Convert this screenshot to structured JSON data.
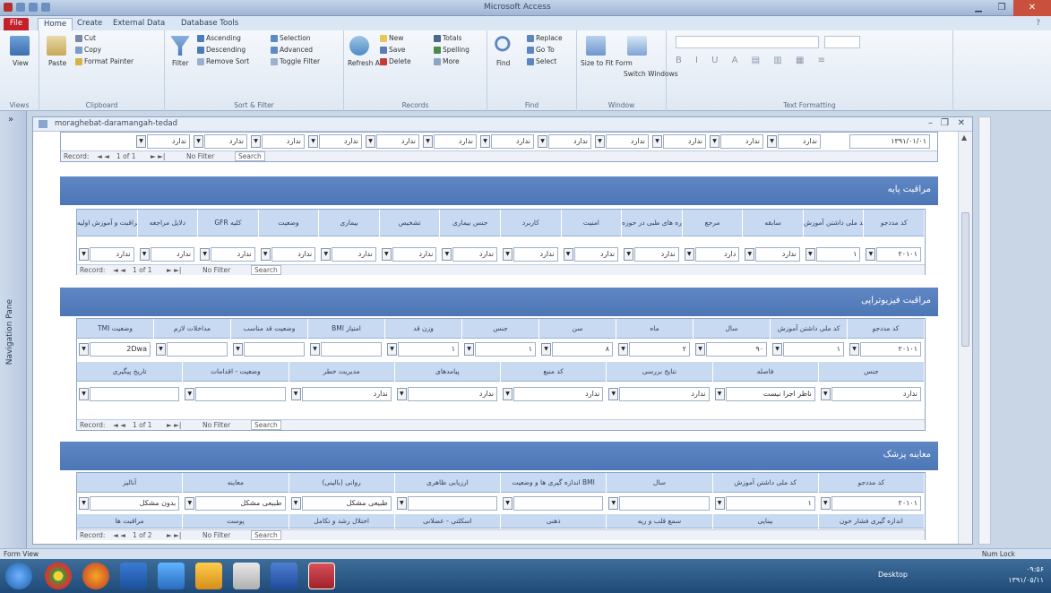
{
  "window": {
    "title": "Microsoft Access"
  },
  "ribbon": {
    "tabs": [
      "File",
      "Home",
      "Create",
      "External Data",
      "Database Tools"
    ],
    "groups": {
      "views": {
        "label": "Views",
        "button": "View"
      },
      "clipboard": {
        "label": "Clipboard",
        "paste": "Paste",
        "cut": "Cut",
        "copy": "Copy",
        "format_painter": "Format Painter"
      },
      "sort_filter": {
        "label": "Sort & Filter",
        "filter": "Filter",
        "ascending": "Ascending",
        "descending": "Descending",
        "remove_sort": "Remove Sort",
        "selection": "Selection",
        "advanced": "Advanced",
        "toggle_filter": "Toggle Filter"
      },
      "records": {
        "label": "Records",
        "refresh": "Refresh All",
        "new": "New",
        "save": "Save",
        "delete": "Delete",
        "totals": "Totals",
        "spelling": "Spelling",
        "more": "More"
      },
      "find": {
        "label": "Find",
        "find": "Find",
        "replace": "Replace",
        "goto": "Go To",
        "select": "Select"
      },
      "window": {
        "label": "Window",
        "size": "Size to Fit Form",
        "switch": "Switch Windows"
      },
      "text_formatting": {
        "label": "Text Formatting"
      }
    }
  },
  "nav_pane": {
    "label": "Navigation Pane"
  },
  "document": {
    "title": "moraghebat-daramangah-tedad",
    "top_strip": {
      "first_value": "۱۳۹۱/۰۱/۰۱",
      "values": [
        "ندارد",
        "ندارد",
        "ندارد",
        "ندارد",
        "ندارد",
        "ندارد",
        "ندارد",
        "ندارد",
        "ندارد",
        "ندارد",
        "ندارد",
        "ندارد"
      ]
    },
    "recnav1": {
      "record": "Record:",
      "pos": "1 of 1",
      "filter": "No Filter",
      "search": "Search"
    },
    "section1": {
      "title": "مراقبت پایه",
      "headers": [
        "کد مددجو",
        "کد ملی داشتن آموزش",
        "سابقه",
        "مرجع",
        "مشاوره های طبی در حوزه",
        "امنیت",
        "کاربرد",
        "جنس بیماری",
        "تشخیص",
        "بیماری",
        "وضعیت",
        "GFR کلیه",
        "دلایل مراجعه",
        "مراقبت و آموزش اولیه"
      ],
      "values": [
        "۲۰۱۰۱",
        "۱",
        "ندارد",
        "دارد",
        "ندارد",
        "ندارد",
        "ندارد",
        "ندارد",
        "ندارد",
        "ندارد",
        "ندارد",
        "ندارد",
        "ندارد",
        "ندارد"
      ]
    },
    "recnav2": {
      "record": "Record:",
      "pos": "1 of 1",
      "filter": "No Filter",
      "search": "Search"
    },
    "section2": {
      "title": "مراقبت فیزیوتراپی",
      "headers_top": [
        "کد مددجو",
        "کد ملی داشتن آموزش",
        "سال",
        "ماه",
        "سن",
        "جنس",
        "وزن قد",
        "BMI امتیاز",
        "وضعیت قد مناسب",
        "مداخلات لازم",
        "TMI وضعیت"
      ],
      "values_top": [
        "۲۰۱۰۱",
        "۱",
        "۹۰",
        "۲",
        "۸",
        "۱",
        "۱",
        "",
        "",
        "",
        "2Dwa"
      ],
      "headers_bottom": [
        "جنس",
        "فاصله",
        "نتایج بررسی",
        "کد منبع",
        "پیامدهای",
        "مدیریت خطر",
        "وضعیت - اقدامات",
        "تاریخ پیگیری"
      ],
      "values_bottom": [
        "ندارد",
        "ناظر اجرا نیست",
        "ندارد",
        "ندارد",
        "ندارد",
        "ندارد",
        "",
        ""
      ]
    },
    "recnav3": {
      "record": "Record:",
      "pos": "1 of 1",
      "filter": "No Filter",
      "search": "Search"
    },
    "section3": {
      "title": "معاینه پزشک",
      "headers": [
        "کد مددجو",
        "کد ملی داشتن آموزش",
        "سال",
        "اندازه گیری ها و وضعیت BMI",
        "ارزیابی ظاهری",
        "روانی (بالینی)",
        "معاینه",
        "آنالیز"
      ],
      "values": [
        "۲۰۱۰۱",
        "۱",
        "",
        "",
        "",
        "طبیعی مشکل",
        "طبیعی مشکل",
        "بدون مشکل"
      ],
      "headers_bottom": [
        "اندازه گیری فشار خون",
        "بینایی",
        "سمع قلب و ریه",
        "ذهنی",
        "اسکلتی - عضلانی",
        "اختلال رشد و تکامل",
        "پوست",
        "مراقبت ها"
      ]
    },
    "recnav4": {
      "record": "Record:",
      "pos": "1 of 2",
      "filter": "No Filter",
      "search": "Search"
    }
  },
  "statusbar": {
    "left": "Form View",
    "right": "Num Lock"
  },
  "taskbar": {
    "desktop": "Desktop",
    "time": "۰۹:۵۶",
    "date": "۱۳۹۱/۰۵/۱۱"
  },
  "colors": {
    "section_header": "#5a82c0",
    "ribbon_file": "#c4202a",
    "taskbar": "#2a5886"
  }
}
